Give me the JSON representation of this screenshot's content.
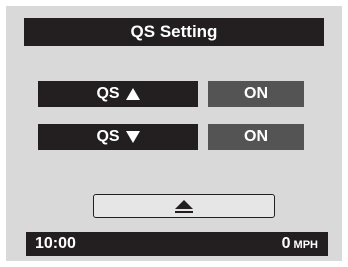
{
  "title": "QS Setting",
  "settings": [
    {
      "label": "QS",
      "arrow": "up-arrow-icon",
      "value": "ON"
    },
    {
      "label": "QS",
      "arrow": "down-arrow-icon",
      "value": "ON"
    }
  ],
  "back_button": {
    "icon": "eject-icon"
  },
  "status": {
    "clock": "10:00",
    "speed": "0",
    "unit": "MPH"
  },
  "colors": {
    "bar": "#231f20",
    "value_bg": "#545454",
    "screen_bg": "#d9d9d9"
  }
}
